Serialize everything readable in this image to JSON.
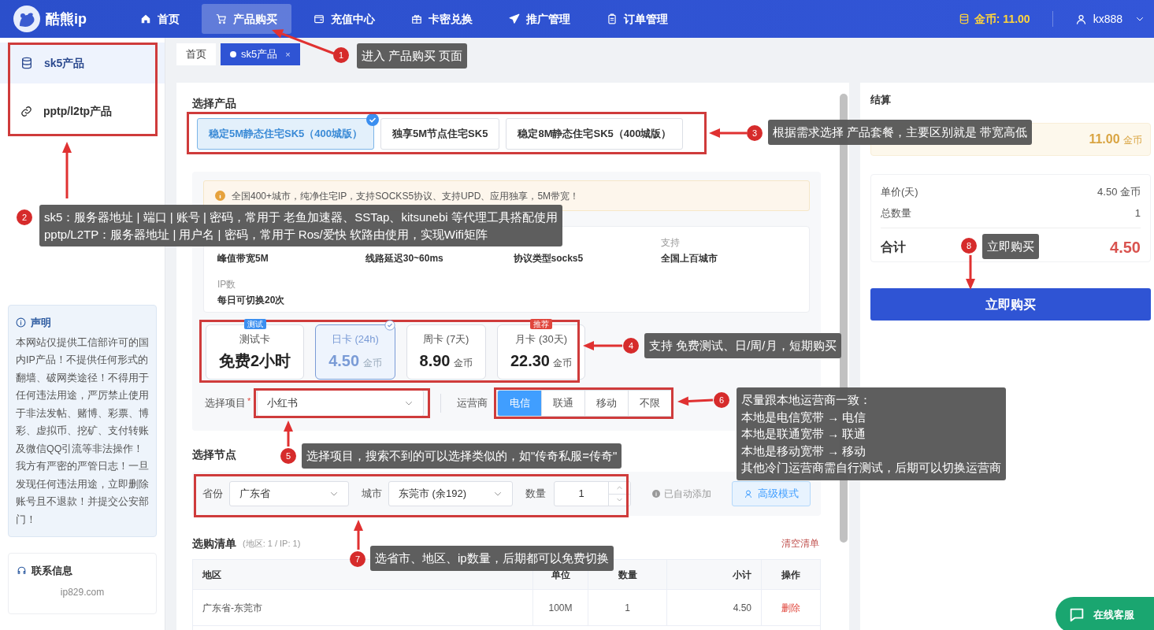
{
  "header": {
    "logo": "酷熊ip",
    "nav": [
      {
        "label": "首页",
        "kind": "home",
        "selected": false
      },
      {
        "label": "产品购买",
        "kind": "cart",
        "selected": true
      },
      {
        "label": "充值中心",
        "kind": "wallet",
        "selected": false
      },
      {
        "label": "卡密兑换",
        "kind": "gift",
        "selected": false
      },
      {
        "label": "推广管理",
        "kind": "plane",
        "selected": false
      },
      {
        "label": "订单管理",
        "kind": "clipboard",
        "selected": false
      }
    ],
    "coins": "金币: 11.00",
    "user": "kx888"
  },
  "sidebar": {
    "items": [
      {
        "label": "sk5产品",
        "kind": "database",
        "selected": true
      },
      {
        "label": "pptp/l2tp产品",
        "kind": "link",
        "selected": false
      }
    ],
    "notice": {
      "title": "声明",
      "text": "本网站仅提供工信部许可的国内IP产品！不提供任何形式的翻墙、破网类途径！不得用于任何违法用途，严厉禁止使用于非法发帖、赌博、彩票、博彩、虚拟币、挖矿、支付转账及微信QQ引流等非法操作！我方有严密的严管日志！一旦发现任何违法用途，立即删除账号且不退款！并提交公安部门！"
    },
    "contact": {
      "title": "联系信息",
      "text": "ip829.com"
    }
  },
  "tabs": [
    {
      "label": "首页",
      "selected": false
    },
    {
      "label": "sk5产品",
      "selected": true,
      "close": "×"
    }
  ],
  "products": {
    "title": "选择产品",
    "items": [
      {
        "label": "稳定5M静态住宅SK5（400城版）",
        "selected": true
      },
      {
        "label": "独享5M节点住宅SK5",
        "selected": false
      },
      {
        "label": "稳定8M静态住宅SK5（400城版）",
        "selected": false
      }
    ]
  },
  "notice_bar": "全国400+城市，纯净住宅IP，支持SOCKS5协议、支持UPD、应用独享，5M带宽！",
  "specs": [
    {
      "value": "峰值带宽5M"
    },
    {
      "value": "线路延迟30~60ms"
    },
    {
      "value": "协议类型socks5"
    },
    {
      "label": "支持",
      "value": "全国上百城市"
    },
    {
      "label": "IP数",
      "value": "每日可切换20次"
    }
  ],
  "plans": [
    {
      "name": "测试卡",
      "price": "免费2小时",
      "badge": "测试",
      "color": "#3b8ff0",
      "selected": false
    },
    {
      "name": "日卡 (24h)",
      "price": "4.50",
      "unit": "金币",
      "selected": true
    },
    {
      "name": "周卡 (7天)",
      "price": "8.90",
      "unit": "金币",
      "selected": false
    },
    {
      "name": "月卡 (30天)",
      "price": "22.30",
      "unit": "金币",
      "badge": "推荐",
      "color": "#e0463c",
      "selected": false
    }
  ],
  "project": {
    "label": "选择项目",
    "required_mark": "*",
    "value": "小红书"
  },
  "carrier": {
    "label": "运营商",
    "options": [
      {
        "label": "电信",
        "selected": true
      },
      {
        "label": "联通",
        "selected": false
      },
      {
        "label": "移动",
        "selected": false
      },
      {
        "label": "不限",
        "selected": false
      }
    ]
  },
  "node": {
    "title": "选择节点",
    "province_label": "省份",
    "province": "广东省",
    "city_label": "城市",
    "city": "东莞市 (余192)",
    "qty_label": "数量",
    "qty": "1",
    "auto_note": "已自动添加",
    "advanced": "高级模式"
  },
  "cart": {
    "title": "选购清单",
    "meta": "(地区: 1 / IP: 1)",
    "clear": "清空清单",
    "columns": [
      "地区",
      "单位",
      "数量",
      "小计",
      "操作"
    ],
    "rows": [
      [
        "广东省-东莞市",
        "100M",
        "1",
        "4.50",
        "删除"
      ]
    ]
  },
  "checkout": {
    "title": "结算",
    "balance": "11.00",
    "balance_unit": "金币",
    "unit_price_label": "单价(天)",
    "unit_price": "4.50 金币",
    "qty_label": "总数量",
    "qty": "1",
    "total_label": "合计",
    "total": "4.50",
    "buy": "立即购买"
  },
  "support": "在线客服",
  "annotations": [
    {
      "number": "1",
      "lines": [
        "进入 产品购买 页面"
      ]
    },
    {
      "number": "2",
      "lines": [
        "sk5：服务器地址 | 端口 | 账号 | 密码，常用于 老鱼加速器、SSTap、kitsunebi 等代理工具搭配使用",
        "pptp/L2TP：服务器地址 | 用户名 | 密码，常用于 Ros/爱快 软路由使用，实现Wifi矩阵"
      ]
    },
    {
      "number": "3",
      "lines": [
        "根据需求选择 产品套餐，主要区别就是 带宽高低"
      ]
    },
    {
      "number": "4",
      "lines": [
        "支持 免费测试、日/周/月，短期购买"
      ]
    },
    {
      "number": "5",
      "lines": [
        "选择项目，搜索不到的可以选择类似的，如\"传奇私服=传奇\""
      ]
    },
    {
      "number": "6",
      "lines": [
        "尽量跟本地运营商一致：",
        "本地是电信宽带 → 电信",
        "本地是联通宽带 → 联通",
        "本地是移动宽带 → 移动",
        "其他冷门运营商需自行测试，后期可以切换运营商"
      ]
    },
    {
      "number": "7",
      "lines": [
        "选省市、地区、ip数量，后期都可以免费切换"
      ]
    },
    {
      "number": "8",
      "lines": [
        "立即购买"
      ]
    }
  ]
}
